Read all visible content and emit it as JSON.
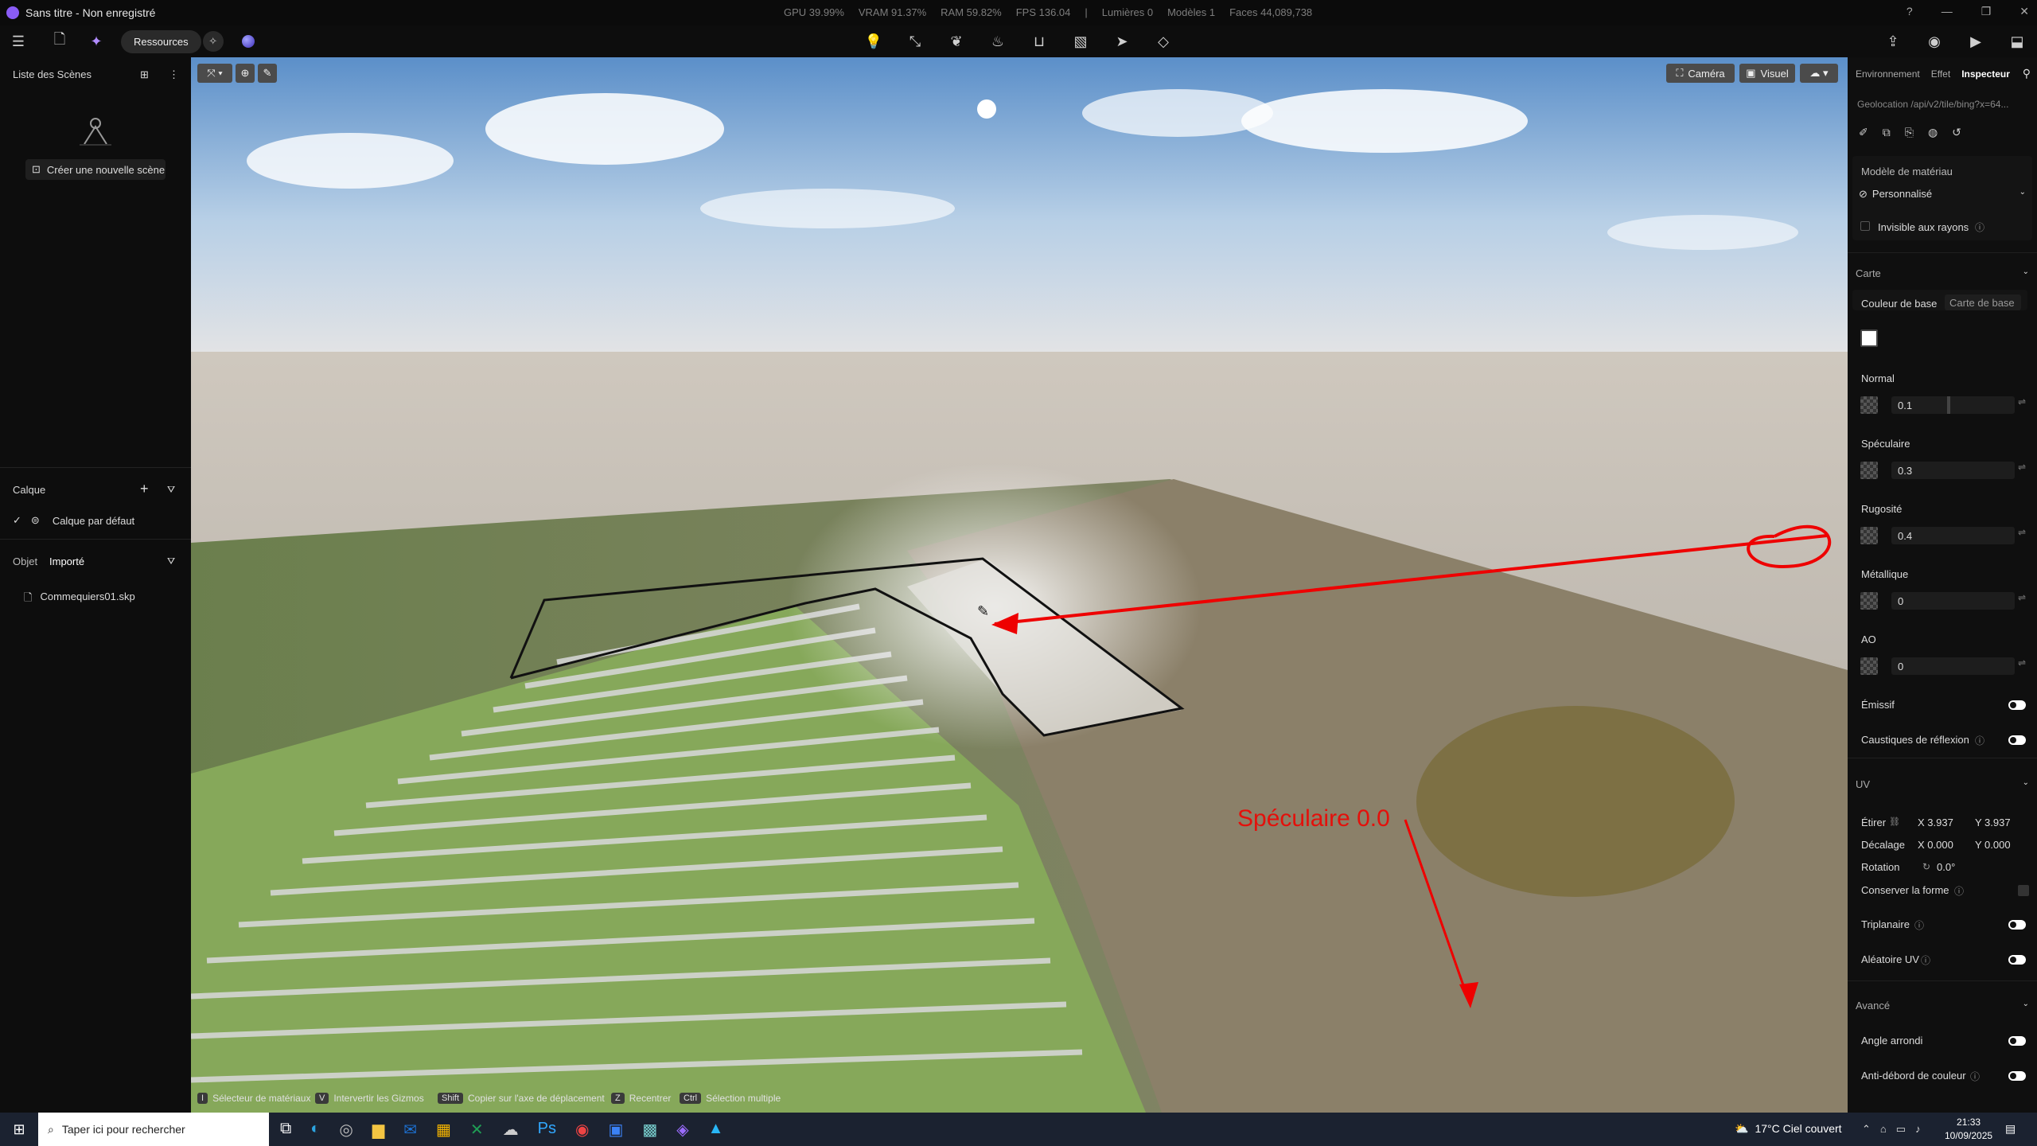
{
  "window": {
    "title": "Sans titre - Non enregistré",
    "stats": [
      "GPU 39.99%",
      "VRAM 91.37%",
      "RAM 59.82%",
      "FPS 136.04",
      "|",
      "Lumières 0",
      "Modèles 1",
      "Faces 44,089,738"
    ]
  },
  "toolbar": {
    "resources_label": "Ressources"
  },
  "left_panel": {
    "scenes_title": "Liste des Scènes",
    "new_scene_label": "Créer une nouvelle scène",
    "layer_title": "Calque",
    "default_layer": "Calque par défaut",
    "object_title": "Objet",
    "object_filter": "Importé",
    "file_name": "Commequiers01.skp"
  },
  "viewport": {
    "camera_label": "Caméra",
    "visual_label": "Visuel",
    "annotation_text": "Spéculaire 0.0",
    "hints": [
      {
        "key": "I",
        "label": "Sélecteur de matériaux"
      },
      {
        "key": "V",
        "label": "Intervertir les Gizmos"
      },
      {
        "key": "Shift",
        "label": "Copier sur l'axe de déplacement"
      },
      {
        "key": "Z",
        "label": "Recentrer"
      },
      {
        "key": "Ctrl",
        "label": "Sélection multiple"
      }
    ]
  },
  "inspector": {
    "tabs": [
      "Environnement",
      "Effet",
      "Inspecteur"
    ],
    "geolocation": "Geolocation /api/v2/tile/bing?x=64...",
    "material_model_label": "Modèle de matériau",
    "material_model_value": "Personnalisé",
    "invisible_rays": "Invisible aux rayons",
    "map_section": "Carte",
    "base_color_tab": "Couleur de base",
    "base_map_tab": "Carte de base",
    "normal_label": "Normal",
    "normal_value": "0.1",
    "specular_label": "Spéculaire",
    "specular_value": "0.3",
    "roughness_label": "Rugosité",
    "roughness_value": "0.4",
    "metallic_label": "Métallique",
    "metallic_value": "0",
    "ao_label": "AO",
    "ao_value": "0",
    "emissive_label": "Émissif",
    "caustics_label": "Caustiques de réflexion",
    "uv_section": "UV",
    "stretch_label": "Étirer",
    "stretch_x": "X 3.937",
    "stretch_y": "Y 3.937",
    "offset_label": "Décalage",
    "offset_x": "X 0.000",
    "offset_y": "Y 0.000",
    "rotation_label": "Rotation",
    "rotation_value": "0.0°",
    "keep_shape_label": "Conserver la forme",
    "triplanar_label": "Triplanaire",
    "random_uv_label": "Aléatoire UV",
    "advanced_section": "Avancé",
    "rounded_angle_label": "Angle arrondi",
    "anti_bleed_label": "Anti-débord de couleur"
  },
  "taskbar": {
    "search_placeholder": "Taper ici pour rechercher",
    "weather": "17°C  Ciel couvert",
    "time": "21:33",
    "date": "10/09/2025"
  }
}
